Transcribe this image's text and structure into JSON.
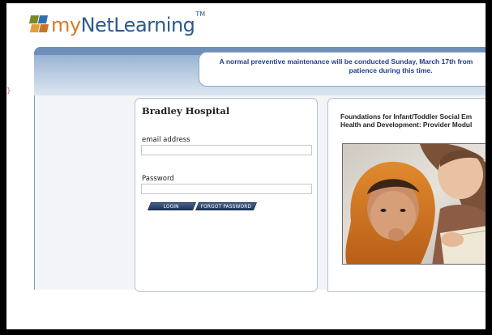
{
  "logo": {
    "my": "my",
    "net": "NetLearning",
    "tm": "TM"
  },
  "notice": {
    "line1": "A normal preventive maintenance will be conducted Sunday, March 17th from",
    "line2": "patience during this time."
  },
  "login": {
    "org_name": "Bradley Hospital",
    "email_label": "email address",
    "email_value": "",
    "password_label": "Password",
    "password_value": "",
    "login_button": "LOGIN",
    "forgot_button": "FORGOT PASSWORD"
  },
  "feature": {
    "title_line1": "Foundations for Infant/Toddler Social Em",
    "title_line2": "Health and Development: Provider Modul"
  },
  "colors": {
    "brand_blue": "#2d5a8e",
    "brand_orange": "#d77a2a",
    "notice_text": "#1f3f8a",
    "button_navy": "#2b4268"
  }
}
